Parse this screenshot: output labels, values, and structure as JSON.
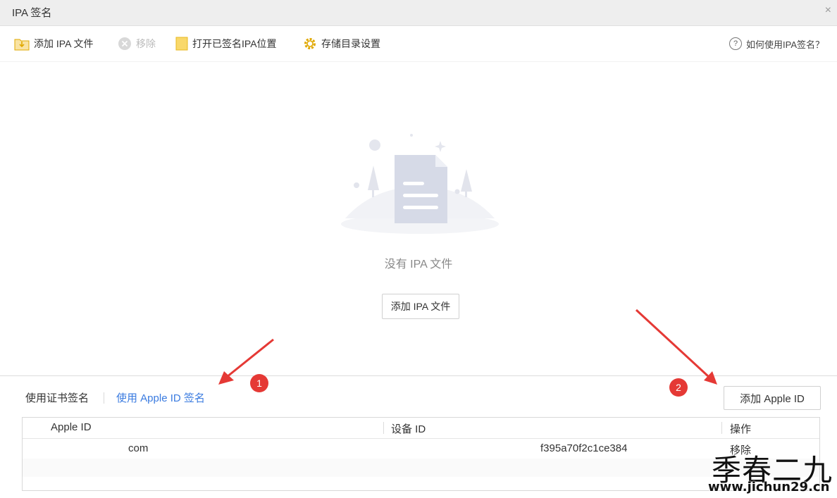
{
  "window": {
    "title": "IPA 签名",
    "close_label": "×"
  },
  "toolbar": {
    "add_ipa": "添加 IPA 文件",
    "remove": "移除",
    "open_signed": "打开已签名IPA位置",
    "storage_settings": "存储目录设置",
    "help": "如何使用IPA签名？",
    "help_icon_char": "?"
  },
  "empty": {
    "message": "没有 IPA 文件",
    "add_button": "添加 IPA 文件"
  },
  "tabs": {
    "cert_sign": "使用证书签名",
    "appleid_sign": "使用 Apple ID 签名"
  },
  "add_appleid_button": "添加 Apple ID",
  "table": {
    "headers": {
      "apple_id": "Apple ID",
      "device_id": "设备 ID",
      "action": "操作"
    },
    "rows": [
      {
        "apple_id": "com",
        "device_id": "f395a70f2c1ce384",
        "action": "移除"
      }
    ]
  },
  "annotations": {
    "badge1": "1",
    "badge2": "2"
  },
  "watermark": {
    "chinese": "季春二九",
    "url": "www.jichun29.cn"
  },
  "colors": {
    "accent_blue": "#3a7be0",
    "annotation_red": "#e53935",
    "folder_yellow": "#f5c242"
  }
}
